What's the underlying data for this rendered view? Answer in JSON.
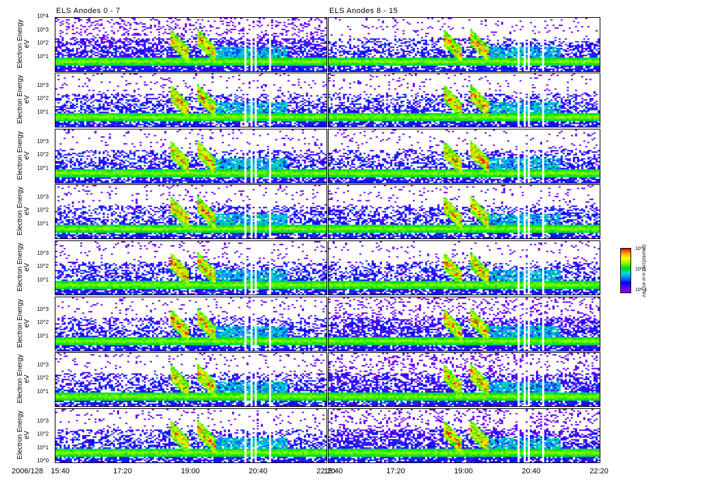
{
  "chart_data": {
    "type": "heatmap",
    "titles": [
      "ELS Anodes 0 - 7",
      "ELS Anodes 8 - 15"
    ],
    "ylabel": "Electron Energy",
    "yunit": "eV",
    "yscale": "log",
    "ylim": [
      1,
      10000
    ],
    "ytick_labels": [
      "10^0",
      "10^1",
      "10^2",
      "10^3",
      "10^4"
    ],
    "date_label": "2006/128",
    "xtick_labels": [
      "15:40",
      "17:20",
      "19:00",
      "20:40",
      "22:20"
    ],
    "xlim_minutes": [
      940,
      1340
    ],
    "panels_per_column": 8,
    "background_band_eV": 6,
    "events_minutes": [
      1120,
      1160
    ],
    "data_gaps_minutes": [
      1218,
      1227,
      1234,
      1256
    ],
    "colorbar": {
      "labels": [
        "10^1",
        "10^0",
        "10^-1"
      ],
      "title": "Counts/(cm2-s-sr-eV)/eV",
      "colors": [
        "#ff0000",
        "#ffff00",
        "#00dd00",
        "#00dddd",
        "#0000ff",
        "#8000ff"
      ]
    }
  }
}
